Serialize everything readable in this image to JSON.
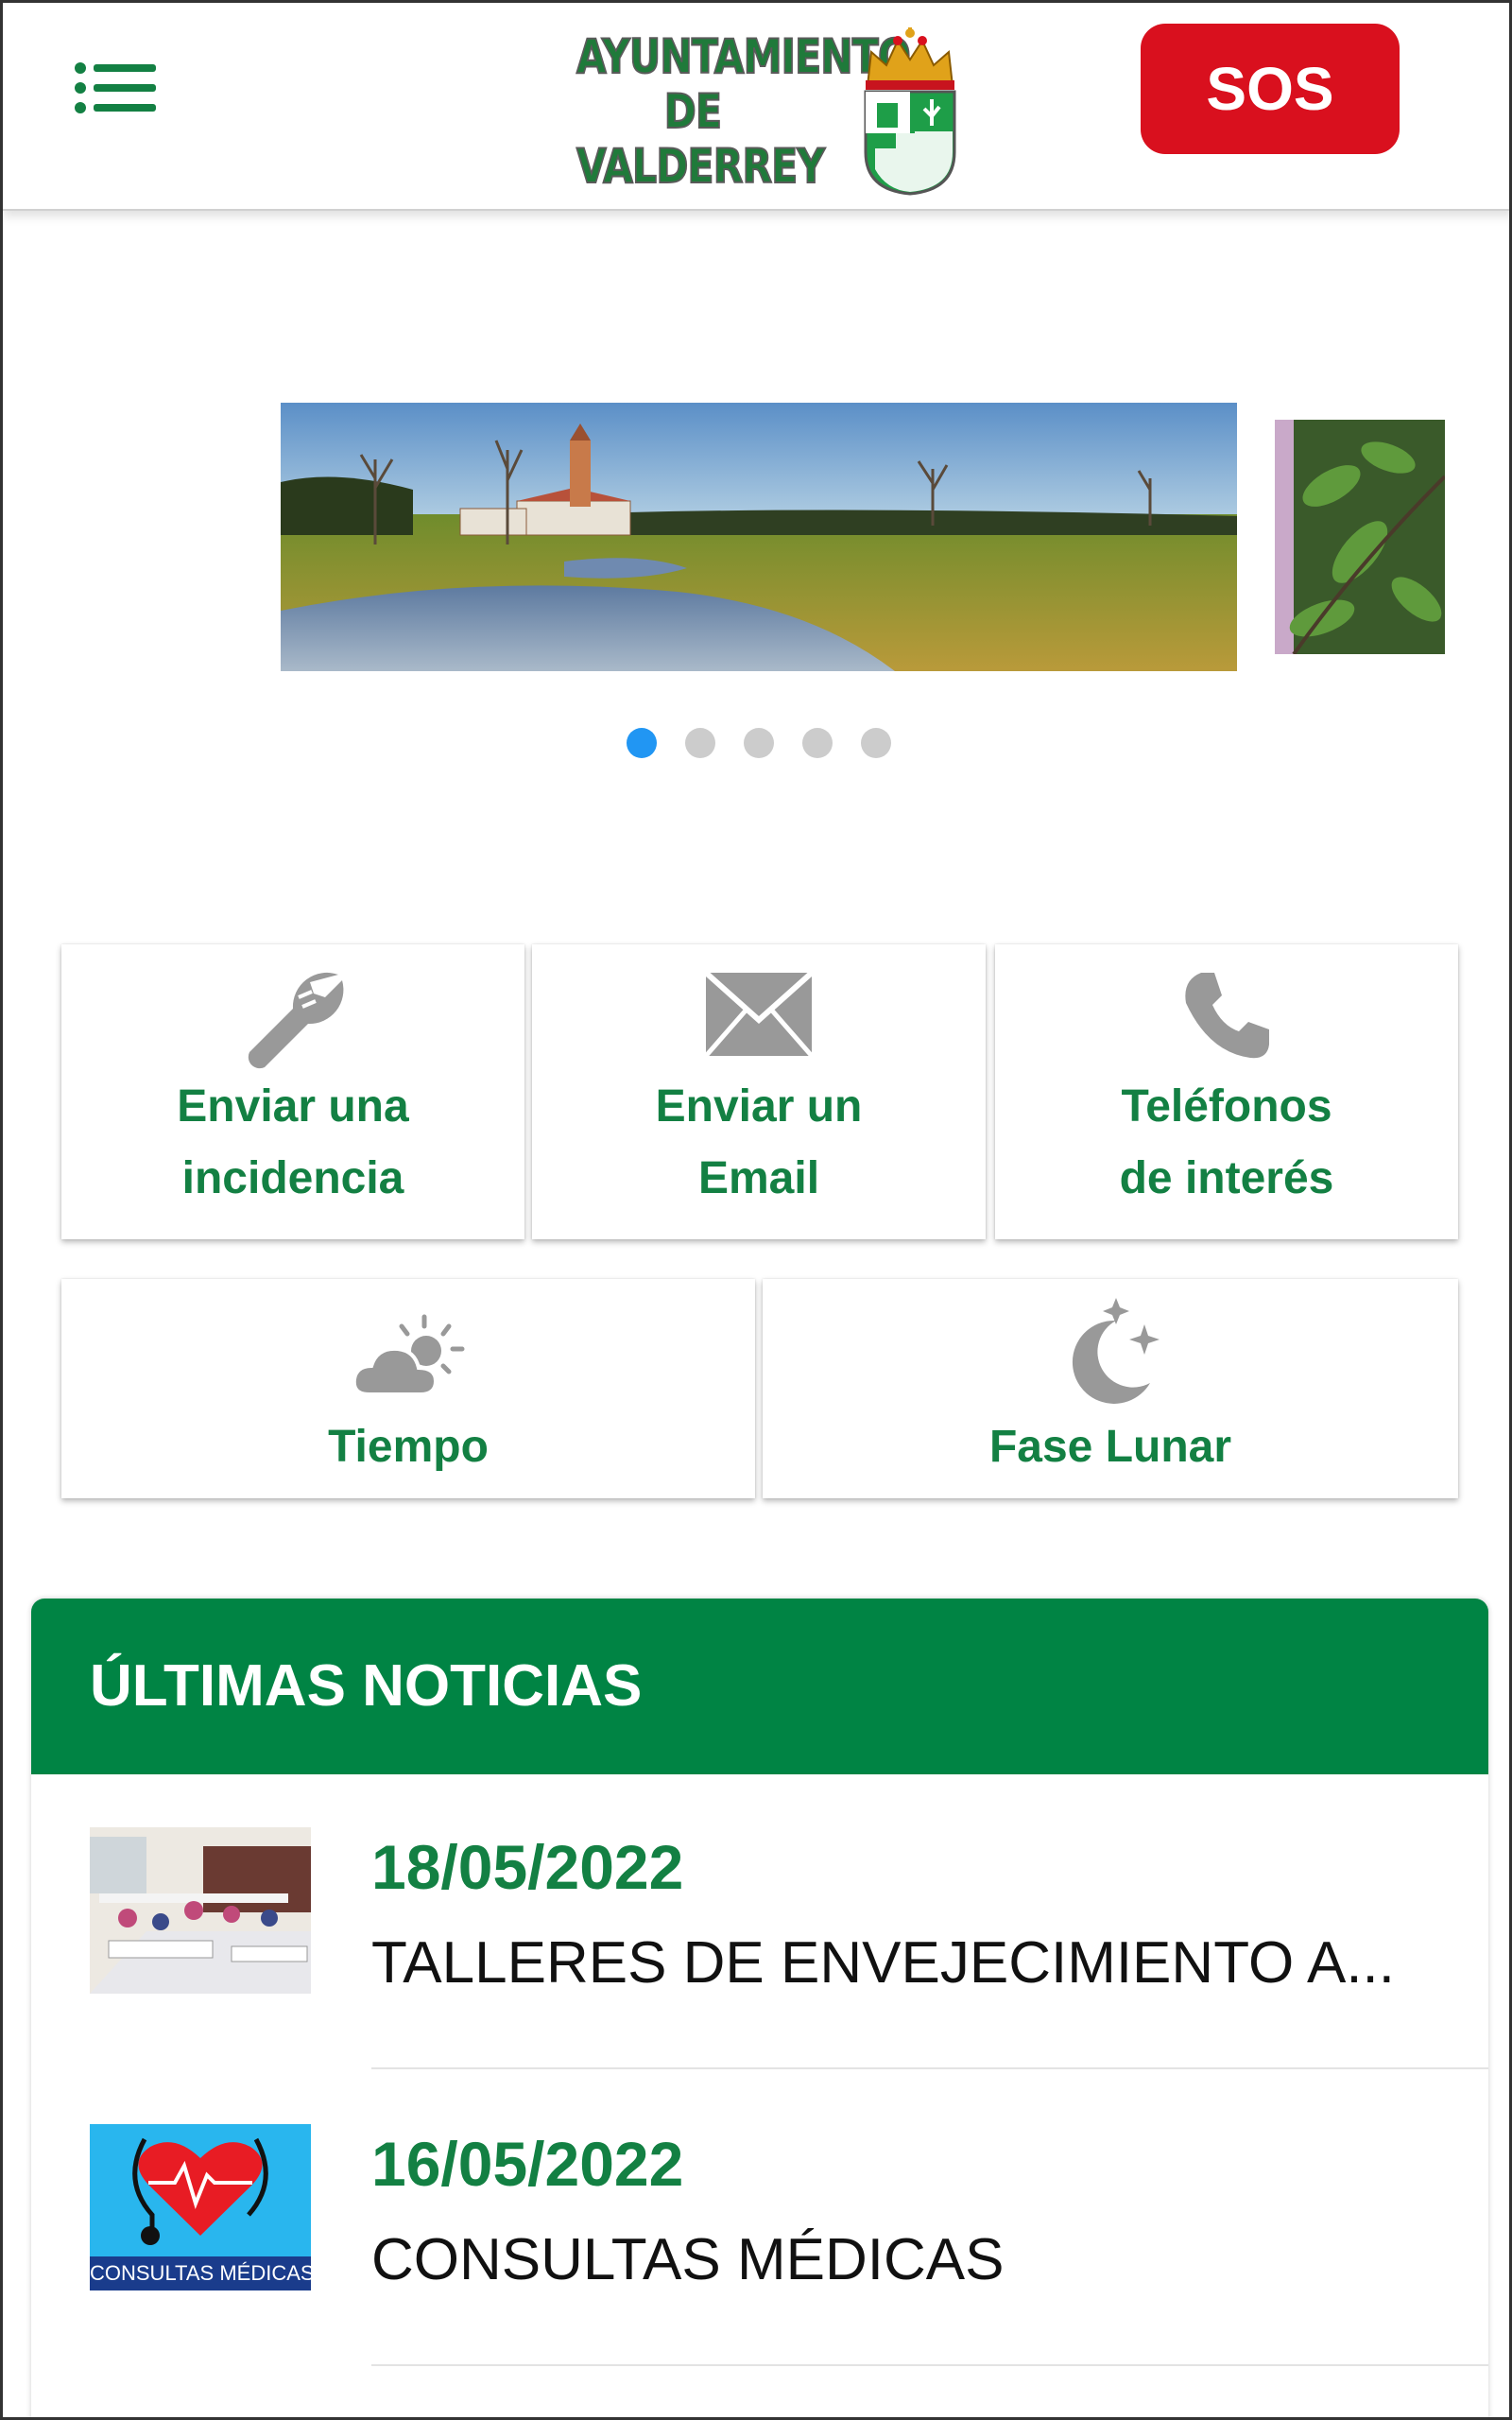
{
  "header": {
    "menu_icon": "list-menu-icon",
    "logo_lines": [
      "AYUNTAMIENTO",
      "DE",
      "VALDERREY"
    ],
    "crest_icon": "coat-of-arms-icon",
    "sos_label": "SOS",
    "colors": {
      "brand_green": "#1f7a3a",
      "sos_red": "#d9101e"
    }
  },
  "carousel": {
    "slide_count": 5,
    "active_index": 0,
    "dot_active_color": "#2196f3",
    "dot_inactive_color": "#cccccc"
  },
  "actions": {
    "row1": [
      {
        "icon": "wrench-icon",
        "line1": "Enviar una",
        "line2": "incidencia"
      },
      {
        "icon": "envelope-icon",
        "line1": "Enviar un",
        "line2": "Email"
      },
      {
        "icon": "phone-icon",
        "line1": "Teléfonos",
        "line2": "de interés"
      }
    ],
    "row2": [
      {
        "icon": "weather-icon",
        "label": "Tiempo"
      },
      {
        "icon": "moon-icon",
        "label": "Fase Lunar"
      }
    ],
    "label_color": "#138043",
    "icon_color": "#999999"
  },
  "news": {
    "title": "ÚLTIMAS NOTICIAS",
    "header_color": "#008444",
    "items": [
      {
        "date": "18/05/2022",
        "headline": "TALLERES DE ENVEJECIMIENTO A..."
      },
      {
        "date": "16/05/2022",
        "headline": "CONSULTAS MÉDICAS",
        "thumb_caption": "CONSULTAS MÉDICAS"
      }
    ]
  }
}
